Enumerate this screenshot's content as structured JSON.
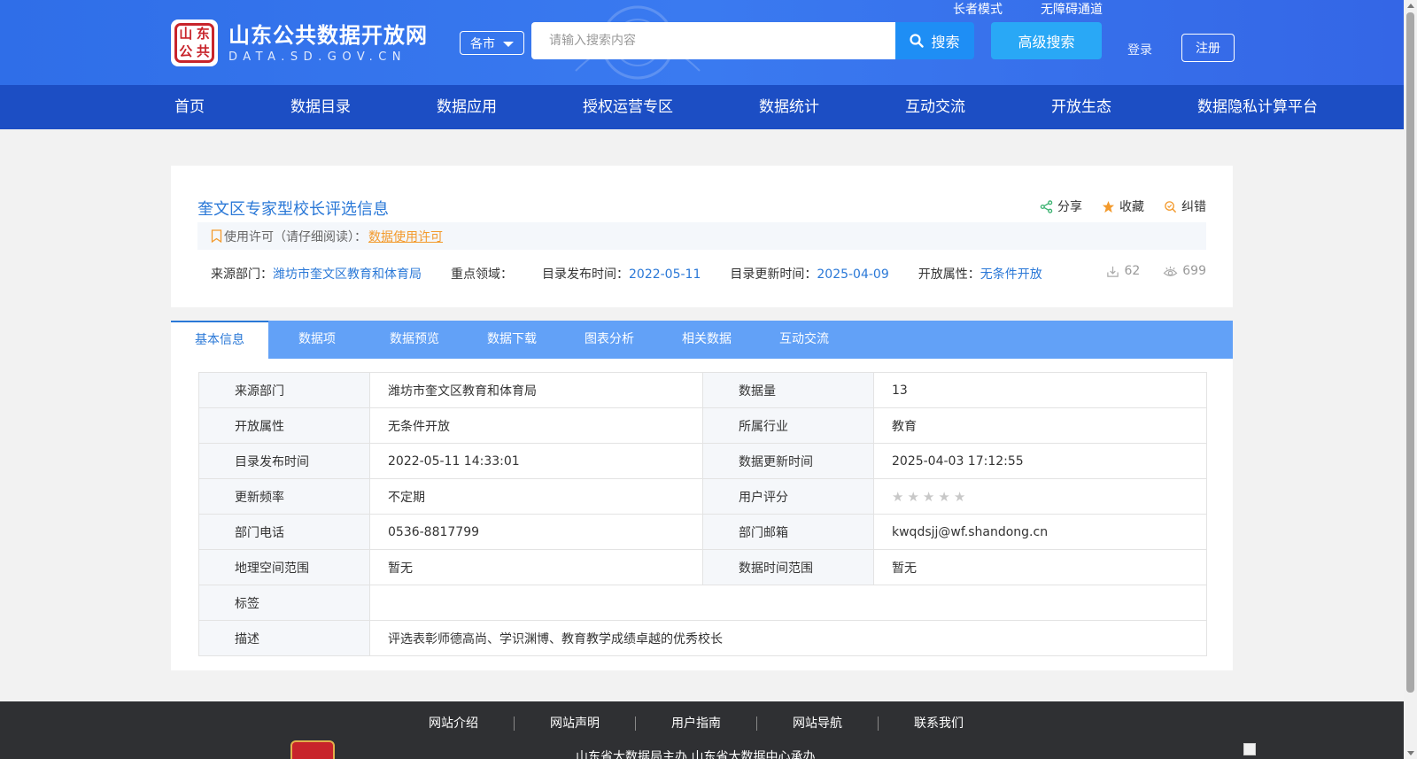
{
  "header": {
    "logo_cn": "山东公共数据开放网",
    "logo_en": "DATA.SD.GOV.CN",
    "seal_chars": [
      "山",
      "东",
      "公",
      "共"
    ],
    "elder_mode": "长者模式",
    "accessibility": "无障碍通道",
    "city_select": "各市",
    "search_placeholder": "请输入搜索内容",
    "search_button": "搜索",
    "advanced_search": "高级搜索",
    "login": "登录",
    "register": "注册"
  },
  "nav": {
    "items": [
      "首页",
      "数据目录",
      "数据应用",
      "授权运营专区",
      "数据统计",
      "互动交流",
      "开放生态",
      "数据隐私计算平台"
    ]
  },
  "dataset": {
    "title": "奎文区专家型校长评选信息",
    "actions": {
      "share": "分享",
      "favorite": "收藏",
      "correct": "纠错"
    },
    "license_label": "使用许可（请仔细阅读）：",
    "license_link": "数据使用许可",
    "meta": {
      "source_label": "来源部门：",
      "source_value": "潍坊市奎文区教育和体育局",
      "domain_label": "重点领域：",
      "domain_value": "",
      "publish_label": "目录发布时间：",
      "publish_value": "2022-05-11",
      "update_label": "目录更新时间：",
      "update_value": "2025-04-09",
      "open_label": "开放属性：",
      "open_value": "无条件开放"
    },
    "downloads": "62",
    "views": "699"
  },
  "tabs": [
    "基本信息",
    "数据项",
    "数据预览",
    "数据下载",
    "图表分析",
    "相关数据",
    "互动交流"
  ],
  "info_table": {
    "rows": [
      [
        "来源部门",
        "潍坊市奎文区教育和体育局",
        "数据量",
        "13"
      ],
      [
        "开放属性",
        "无条件开放",
        "所属行业",
        "教育"
      ],
      [
        "目录发布时间",
        "2022-05-11 14:33:01",
        "数据更新时间",
        "2025-04-03 17:12:55"
      ],
      [
        "更新频率",
        "不定期",
        "用户评分",
        ""
      ],
      [
        "部门电话",
        "0536-8817799",
        "部门邮箱",
        "kwqdsjj@wf.shandong.cn"
      ],
      [
        "地理空间范围",
        "暂无",
        "数据时间范围",
        "暂无"
      ]
    ],
    "tags_label": "标签",
    "tags_value": "",
    "desc_label": "描述",
    "desc_value": "评选表彰师德高尚、学识渊博、教育教学成绩卓越的优秀校长",
    "rating": 0
  },
  "footer": {
    "links": [
      "网站介绍",
      "网站声明",
      "用户指南",
      "网站导航",
      "联系我们"
    ],
    "sub": "山东省大数据局主办    山东省大数据中心承办"
  },
  "colors": {
    "header_blue": "#3a7af0",
    "nav_blue": "#1c4ec4",
    "accent": "#2a78d7",
    "tab_bar": "#62a1f7",
    "orange": "#f39a2c"
  }
}
